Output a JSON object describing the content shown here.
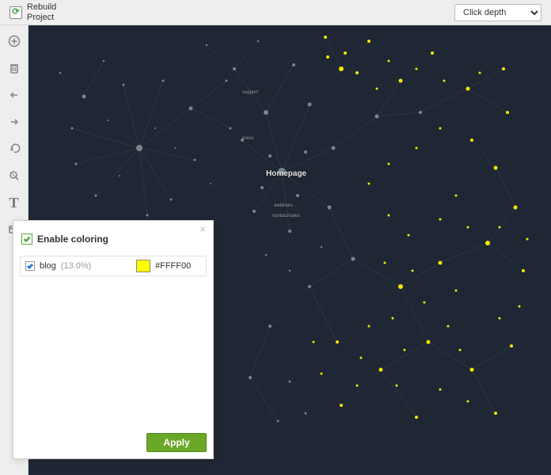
{
  "header": {
    "rebuild_line1": "Rebuild",
    "rebuild_line2": "Project",
    "depth_selected": "Click depth"
  },
  "graph": {
    "labels": {
      "homepage": "Homepage",
      "small1": "support",
      "small2": "press",
      "small3": "webinars",
      "small4": "contact/sales"
    }
  },
  "panel": {
    "enable_label": "Enable coloring",
    "row_name": "blog",
    "row_pct": "(13.0%)",
    "swatch_hex": "#FFFF00",
    "apply_label": "Apply"
  }
}
